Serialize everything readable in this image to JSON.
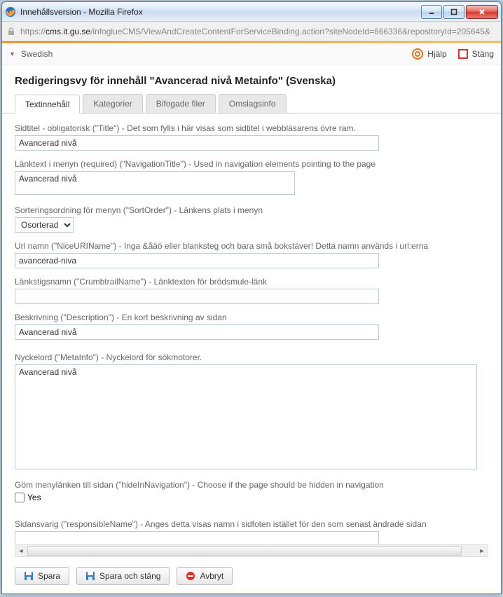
{
  "window": {
    "title": "Innehållsversion - Mozilla Firefox",
    "url_prefix": "https://",
    "url_host": "cms.it.gu.se",
    "url_path": "/infoglueCMS/ViewAndCreateContentForServiceBinding.action?siteNodeId=666336&repositoryId=205645&"
  },
  "toolbar": {
    "language": "Swedish",
    "help": "Hjälp",
    "close": "Stäng"
  },
  "page": {
    "title": "Redigeringsvy för innehåll \"Avancerad nivå Metainfo\" (Svenska)"
  },
  "tabs": [
    {
      "label": "Textinnehåll"
    },
    {
      "label": "Kategorier"
    },
    {
      "label": "Bifogade filer"
    },
    {
      "label": "Omslagsinfo"
    }
  ],
  "fields": {
    "title_label": "Sidtitel - obligatorisk (\"Title\") - Det som fylls i här visas som sidtitel i webbläsarens övre ram.",
    "title_value": "Avancerad nivå",
    "navtitle_label": "Länktext i menyn (required) (\"NavigationTitle\") - Used in navigation elements pointing to the page",
    "navtitle_value": "Avancerad nivå",
    "sortorder_label": "Sorteringsordning för menyn (\"SortOrder\") - Länkens plats i menyn",
    "sortorder_value": "Osorterad",
    "niceuri_label": "Url namn (\"NiceURIName\") - Inga &åäö eller blanksteg och bara små bokstäver! Detta namn används i url:erna",
    "niceuri_value": "avancerad-niva",
    "crumb_label": "Länkstigsnamn (\"CrumbtrailName\") - Länktexten för brödsmule-länk",
    "crumb_value": "",
    "desc_label": "Beskrivning (\"Description\") - En kort beskrivning av sidan",
    "desc_value": "Avancerad nivå",
    "meta_label": "Nyckelord (\"MetaInfo\") - Nyckelord för sökmotorer.",
    "meta_value": "Avancerad nivå",
    "hide_label": "Göm menylänken till sidan (\"hideInNavigation\") - Choose if the page should be hidden in navigation",
    "hide_check": "Yes",
    "resp_label": "Sidansvarig (\"responsibleName\") - Anges detta visas namn i sidfoten istället för den som senast ändrade sidan",
    "resp_value": ""
  },
  "buttons": {
    "save": "Spara",
    "save_close": "Spara och stäng",
    "cancel": "Avbryt"
  }
}
